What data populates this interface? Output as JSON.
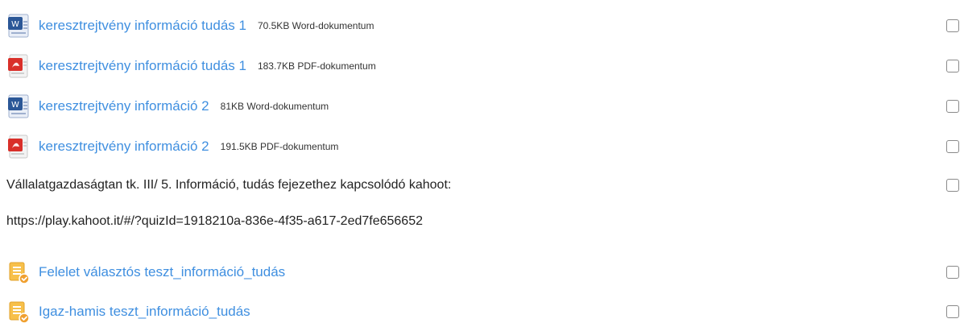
{
  "items": [
    {
      "type": "file",
      "icon": "word-doc-icon",
      "title": "keresztrejtvény információ tudás 1",
      "meta": "70.5KB Word-dokumentum"
    },
    {
      "type": "file",
      "icon": "pdf-icon",
      "title": "keresztrejtvény információ tudás 1",
      "meta": "183.7KB PDF-dokumentum"
    },
    {
      "type": "file",
      "icon": "word-doc-icon",
      "title": "keresztrejtvény információ 2",
      "meta": "81KB Word-dokumentum"
    },
    {
      "type": "file",
      "icon": "pdf-icon",
      "title": "keresztrejtvény információ 2",
      "meta": "191.5KB PDF-dokumentum"
    },
    {
      "type": "label",
      "text": "Vállalatgazdaságtan tk. III/ 5. Információ, tudás fejezethez kapcsolódó kahoot:",
      "url": "https://play.kahoot.it/#/?quizId=1918210a-836e-4f35-a617-2ed7fe656652"
    },
    {
      "type": "quiz",
      "icon": "quiz-icon",
      "title": "Felelet választós teszt_információ_tudás"
    },
    {
      "type": "quiz",
      "icon": "quiz-icon",
      "title": "Igaz-hamis teszt_információ_tudás"
    }
  ],
  "colors": {
    "link": "#3f8fe0",
    "text": "#222222",
    "word": "#2b5797",
    "pdf": "#d9302a",
    "quiz": "#f0a030"
  }
}
